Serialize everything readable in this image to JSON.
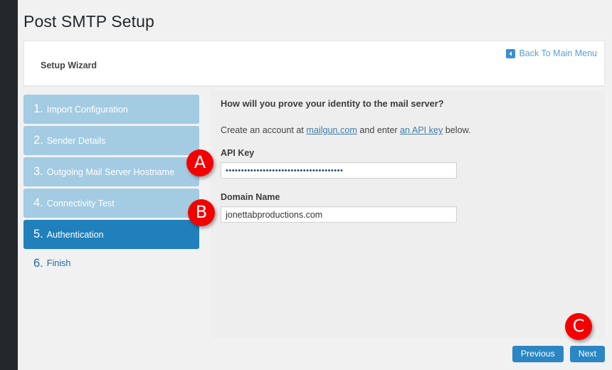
{
  "page": {
    "title": "Post SMTP Setup",
    "accent_blue": "#2b87c4",
    "step_inactive_blue": "#a3cbe2",
    "step_active_blue": "#2080bb",
    "badge_red": "#f50000",
    "background": "#f1f1f1"
  },
  "header": {
    "card_title": "Setup Wizard",
    "back_link": {
      "label": "Back To Main Menu",
      "icon": "arrow-left-box-icon"
    }
  },
  "steps": [
    {
      "number": "1.",
      "label": "Import Configuration",
      "state": "inactive"
    },
    {
      "number": "2.",
      "label": "Sender Details",
      "state": "inactive"
    },
    {
      "number": "3.",
      "label": "Outgoing Mail Server Hostname",
      "state": "inactive"
    },
    {
      "number": "4.",
      "label": "Connectivity Test",
      "state": "inactive"
    },
    {
      "number": "5.",
      "label": "Authentication",
      "state": "active"
    },
    {
      "number": "6.",
      "label": "Finish",
      "state": "plain"
    }
  ],
  "main": {
    "heading": "How will you prove your identity to the mail server?",
    "description": {
      "before": "Create an account at ",
      "link1": "mailgun.com",
      "middle": " and enter ",
      "link2": "an API key",
      "after": " below."
    },
    "fields": [
      {
        "label": "API Key",
        "value": "••••••••••••••••••••••••••••••••••••••",
        "placeholder": "API Key",
        "type": "password"
      },
      {
        "label": "Domain Name",
        "value": "jonettabproductions.com",
        "placeholder": "Domain Name",
        "type": "text"
      }
    ]
  },
  "footer": {
    "previous_label": "Previous",
    "next_label": "Next"
  },
  "annotations": [
    {
      "letter": "A",
      "target": "api-key-input"
    },
    {
      "letter": "B",
      "target": "domain-name-input"
    },
    {
      "letter": "C",
      "target": "next-button"
    }
  ]
}
